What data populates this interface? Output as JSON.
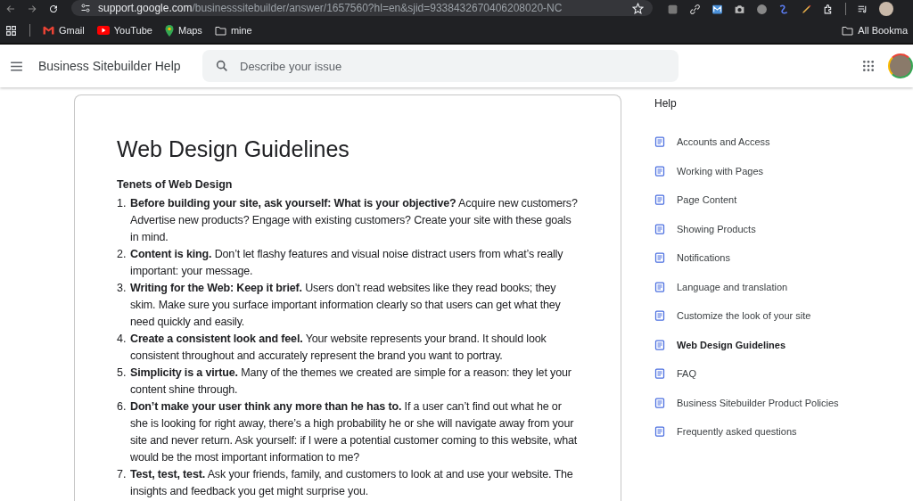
{
  "browser": {
    "url_host": "support.google.com",
    "url_path": "/businesssitebuilder/answer/1657560?hl=en&sjid=9338432670406208020-NC",
    "bookmarks": [
      {
        "label": "Gmail",
        "kind": "gmail"
      },
      {
        "label": "YouTube",
        "kind": "youtube"
      },
      {
        "label": "Maps",
        "kind": "maps"
      },
      {
        "label": "mine",
        "kind": "folder"
      }
    ],
    "all_bookmarks": "All Bookma"
  },
  "header": {
    "title": "Business Sitebuilder Help",
    "search": {
      "placeholder": "Describe your issue"
    }
  },
  "article": {
    "title": "Web Design Guidelines",
    "section_heading": "Tenets of Web Design",
    "items": [
      {
        "number": "1.",
        "text": "**Before building your site, ask yourself: What is your objective?** Acquire new customers? Advertise new products? Engage with existing customers? Create your site with these goals in mind."
      },
      {
        "number": "2.",
        "text": "**Content is king.** Don’t let flashy features and visual noise distract users from what’s really important: your message."
      },
      {
        "number": "3.",
        "text": "**Writing for the Web: Keep it brief.** Users don’t read websites like they read books; they skim. Make sure you surface important information clearly so that users can get what they need quickly and easily."
      },
      {
        "number": "4.",
        "text": "**Create a consistent look and feel.** Your website represents your brand. It should look consistent throughout and accurately represent the brand you want to portray."
      },
      {
        "number": "5.",
        "text": "**Simplicity is a virtue.** Many of the themes we created are simple for a reason: they let your content shine through."
      },
      {
        "number": "6.",
        "text": "**Don’t make your user think any more than he has to.** If a user can’t find out what he or she is looking for right away, there’s a high probability he or she will navigate away from your site and never return. Ask yourself: if I were a potential customer coming to this website, what would be the most important information to me?"
      },
      {
        "number": "7.",
        "text": "**Test, test, test.** Ask your friends, family, and customers to look at and use your website. The insights and feedback you get might surprise you."
      }
    ]
  },
  "sidebar": {
    "heading": "Help",
    "items": [
      {
        "label": "Accounts and Access",
        "selected": false
      },
      {
        "label": "Working with Pages",
        "selected": false
      },
      {
        "label": "Page Content",
        "selected": false
      },
      {
        "label": "Showing Products",
        "selected": false
      },
      {
        "label": "Notifications",
        "selected": false
      },
      {
        "label": "Language and translation",
        "selected": false
      },
      {
        "label": "Customize the look of your site",
        "selected": false
      },
      {
        "label": "Web Design Guidelines",
        "selected": true
      },
      {
        "label": "FAQ",
        "selected": false
      },
      {
        "label": "Business Sitebuilder Product Policies",
        "selected": false
      },
      {
        "label": "Frequently asked questions",
        "selected": false
      }
    ]
  }
}
